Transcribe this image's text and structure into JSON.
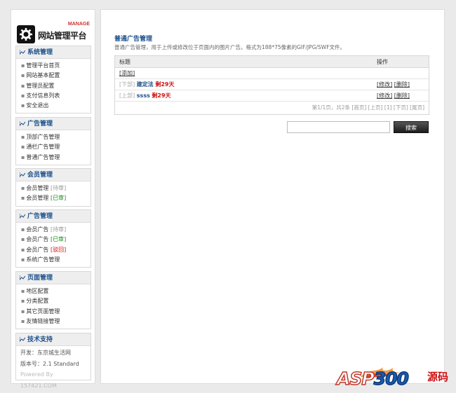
{
  "logo": {
    "manage": "MANAGE",
    "title": "网站管理平台"
  },
  "sidebar": {
    "sections": [
      {
        "title": "系统管理",
        "items": [
          "管理平台首页",
          "网站基本配置",
          "管理员配置",
          "支付信息列表",
          "安全退出"
        ]
      },
      {
        "title": "广告管理",
        "items": [
          "顶部广告管理",
          "通栏广告管理",
          "普通广告管理"
        ]
      },
      {
        "title": "会员管理",
        "items": [
          {
            "label": "会员管理",
            "tag": "[待审]"
          },
          {
            "label": "会员管理",
            "tag": "[已审]"
          }
        ]
      },
      {
        "title": "广告管理",
        "items": [
          {
            "label": "会员广告",
            "tag": "[待审]"
          },
          {
            "label": "会员广告",
            "tag": "[已审]"
          },
          {
            "label": "会员广告",
            "tag": "[驳回]"
          },
          {
            "label": "系统广告管理",
            "tag": ""
          }
        ]
      },
      {
        "title": "页面管理",
        "items": [
          "地区配置",
          "分类配置",
          "其它页面管理",
          "友情链接管理"
        ]
      },
      {
        "title": "技术支持",
        "lines": [
          "开发：东京城生活网",
          "版本号：2.1 Standard",
          "Powered By 157421.COM"
        ]
      }
    ]
  },
  "main": {
    "title": "普通广告管理",
    "description": "普通广告管理，用于上传或修改位于页面内的图片广告。格式为188*75像素的GIF/JPG/SWF文件。",
    "table": {
      "headers": [
        "标题",
        "操作"
      ],
      "add_link": "[添加]",
      "rows": [
        {
          "position": "[下部]",
          "name": "建定法",
          "remain": "剩29天",
          "edit": "[修改]",
          "delete": "[删除]"
        },
        {
          "position": "[上部]",
          "name": "ssss",
          "remain": "剩29天",
          "edit": "[修改]",
          "delete": "[删除]"
        }
      ],
      "pager": "第1/1页，共2条 [首页] [上页] [1] [下页] [尾页]"
    },
    "search": {
      "value": "",
      "button": "搜索"
    }
  },
  "watermark": {
    "text_a": "ASP",
    "text_b": "300",
    "text_c": "源码"
  },
  "colors": {
    "accent": "#1a4f8b",
    "alert": "#d01010",
    "ok": "#1a8a1a"
  }
}
